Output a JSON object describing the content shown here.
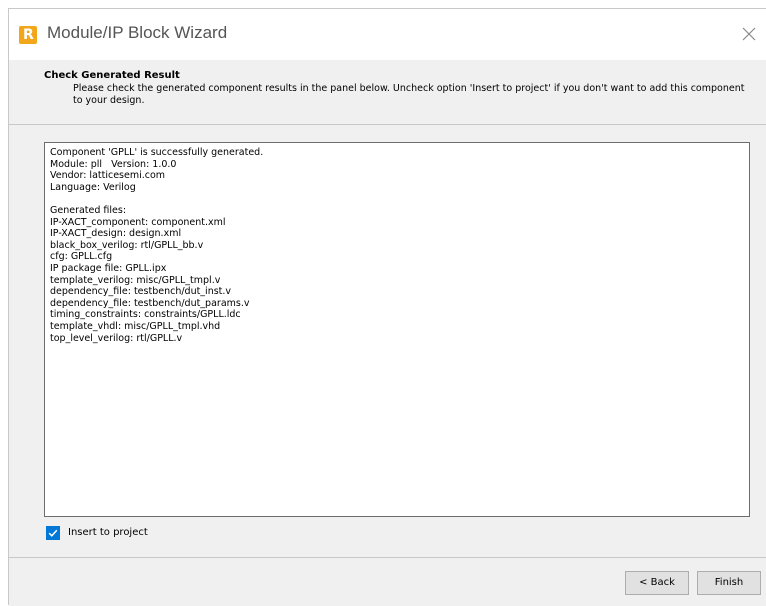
{
  "window": {
    "title": "Module/IP Block Wizard"
  },
  "header": {
    "title": "Check Generated Result",
    "description": "Please check the generated component results in the panel below. Uncheck option 'Insert to project' if you don't want to add this component to your design."
  },
  "result_panel": {
    "text": "Component 'GPLL' is successfully generated.\nModule: pll   Version: 1.0.0\nVendor: latticesemi.com\nLanguage: Verilog\n\nGenerated files:\nIP-XACT_component: component.xml\nIP-XACT_design: design.xml\nblack_box_verilog: rtl/GPLL_bb.v\ncfg: GPLL.cfg\nIP package file: GPLL.ipx\ntemplate_verilog: misc/GPLL_tmpl.v\ndependency_file: testbench/dut_inst.v\ndependency_file: testbench/dut_params.v\ntiming_constraints: constraints/GPLL.ldc\ntemplate_vhdl: misc/GPLL_tmpl.vhd\ntop_level_verilog: rtl/GPLL.v"
  },
  "insert_option": {
    "label": "Insert to project",
    "checked": true
  },
  "buttons": {
    "back": "< Back",
    "finish": "Finish"
  },
  "icons": {
    "app": "lattice-logo-icon",
    "close": "close-icon",
    "check": "checkmark-icon"
  },
  "colors": {
    "accent": "#0078d7",
    "app_icon": "#f2a71b",
    "panel_bg": "#f0f0f0"
  }
}
